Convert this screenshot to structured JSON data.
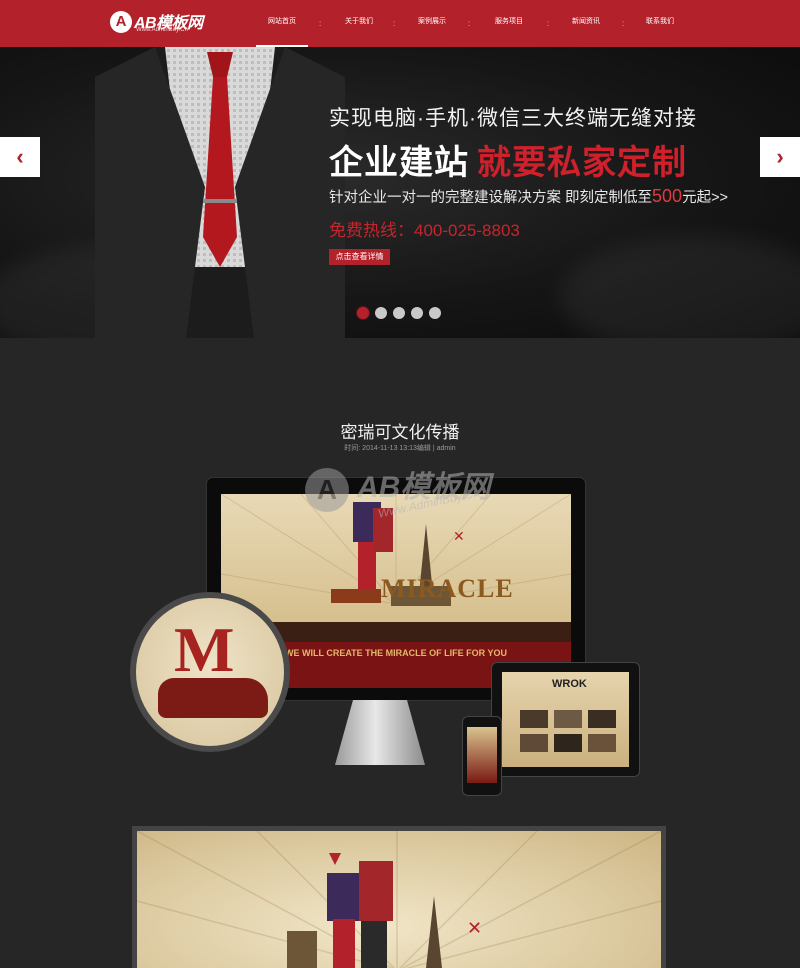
{
  "header": {
    "logo": {
      "mark": "A",
      "name": "AB模板网",
      "sub": "Www.AdminBuy.Cn"
    },
    "nav": [
      {
        "label": "网站首页",
        "active": true
      },
      {
        "label": "关于我们",
        "active": false
      },
      {
        "label": "案例展示",
        "active": false
      },
      {
        "label": "服务项目",
        "active": false
      },
      {
        "label": "新闻资讯",
        "active": false
      },
      {
        "label": "联系我们",
        "active": false
      }
    ],
    "separator": ":"
  },
  "banner": {
    "line1": "实现电脑·手机·微信三大终端无缝对接",
    "line2_white": "企业建站",
    "line2_red": "就要私家定制",
    "line3_pre": "针对企业一对一的完整建设解决方案   即刻定制低至",
    "line3_num": "500",
    "line3_post": "元起>>",
    "hotline": "免费热线：400-025-8803",
    "button": "点击查看详情",
    "prev_icon": "‹",
    "next_icon": "›",
    "slides_count": 5,
    "active_slide": 1
  },
  "post": {
    "title": "密瑞可文化传播",
    "meta": "时间: 2014-11-13 13:13编辑 | admin"
  },
  "showcase": {
    "monitor_word": "MIRACLE",
    "monitor_tagline": "WE WILL CREATE THE MIRACLE OF LIFE FOR YOU",
    "circle_letter": "M",
    "tablet_word": "WROK"
  },
  "watermark": {
    "mark": "A",
    "name": "AB模板网",
    "sub": "Www.AdminBuy.Cn"
  },
  "colors": {
    "brand": "#b3212b",
    "page_bg": "#262626"
  }
}
